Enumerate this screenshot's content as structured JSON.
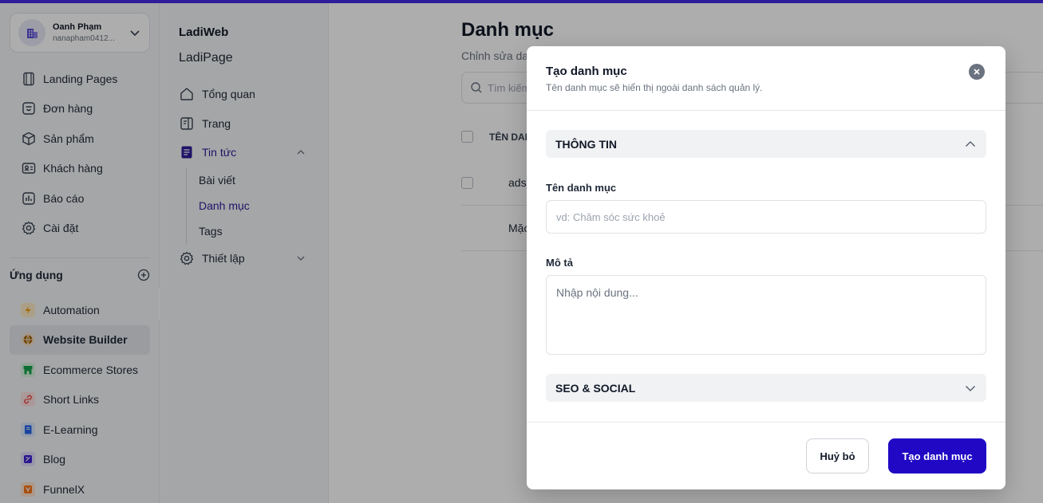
{
  "colors": {
    "brand": "#2d1d9a",
    "primary_button": "#2008c4"
  },
  "account": {
    "name": "Oanh Phạm",
    "email": "nanapham0412...",
    "icon": "building-icon"
  },
  "nav": [
    {
      "label": "Landing Pages",
      "icon": "landing-pages-icon"
    },
    {
      "label": "Đơn hàng",
      "icon": "orders-icon"
    },
    {
      "label": "Sản phẩm",
      "icon": "products-icon"
    },
    {
      "label": "Khách hàng",
      "icon": "customers-icon"
    },
    {
      "label": "Báo cáo",
      "icon": "reports-icon"
    },
    {
      "label": "Cài đặt",
      "icon": "settings-icon"
    }
  ],
  "apps": {
    "title": "Ứng dụng",
    "items": [
      {
        "label": "Automation",
        "icon": "lightning-icon",
        "color": "#f59e0b"
      },
      {
        "label": "Website Builder",
        "icon": "globe-icon",
        "color": "#92400e",
        "active": true
      },
      {
        "label": "Ecommerce Stores",
        "icon": "store-icon",
        "color": "#16a34a"
      },
      {
        "label": "Short Links",
        "icon": "link-icon",
        "color": "#ef4444"
      },
      {
        "label": "E-Learning",
        "icon": "book-icon",
        "color": "#2563eb"
      },
      {
        "label": "Blog",
        "icon": "blog-icon",
        "color": "#3b1fd0"
      },
      {
        "label": "FunnelX",
        "icon": "funnel-icon",
        "color": "#f97316"
      }
    ]
  },
  "subnav": {
    "brand": "LadiWeb",
    "sub": "LadiPage",
    "items": {
      "overview": "Tổng quan",
      "pages": "Trang",
      "news": "Tin tức",
      "posts": "Bài viết",
      "categories": "Danh mục",
      "tags": "Tags",
      "setup": "Thiết lập"
    }
  },
  "main": {
    "title": "Danh mục",
    "subtitle": "Chỉnh sửa danh mục",
    "search_placeholder": "Tìm kiếm",
    "table_header": "TÊN DANH MỤC",
    "rows": [
      "ads",
      "Mặc định"
    ]
  },
  "modal": {
    "title": "Tạo danh mục",
    "description": "Tên danh mục sẽ hiển thị ngoài danh sách quản lý.",
    "section_info": "THÔNG TIN",
    "name_label": "Tên danh mục",
    "name_placeholder": "vd: Chăm sóc sức khoẻ",
    "desc_label": "Mô tả",
    "desc_placeholder": "Nhập nội dung...",
    "section_seo": "SEO & SOCIAL",
    "cancel_label": "Huỷ bỏ",
    "create_label": "Tạo danh mục"
  }
}
